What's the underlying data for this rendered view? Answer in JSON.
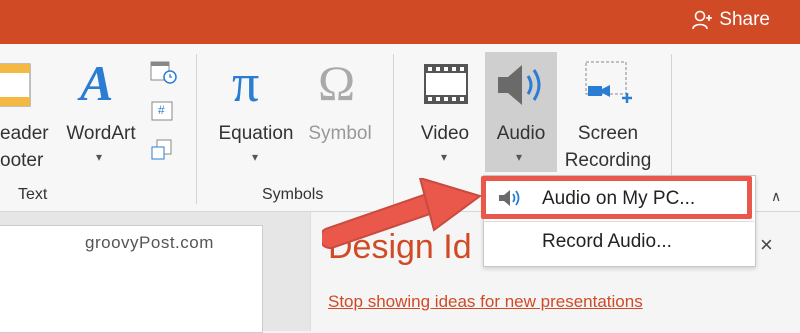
{
  "titlebar": {
    "share_label": "Share"
  },
  "ribbon": {
    "header_footer": {
      "line1": "eader",
      "line2": "ooter"
    },
    "wordart": {
      "label": "WordArt"
    },
    "equation": {
      "label": "Equation"
    },
    "symbol": {
      "label": "Symbol"
    },
    "video": {
      "label": "Video"
    },
    "audio": {
      "label": "Audio"
    },
    "screen_recording": {
      "line1": "Screen",
      "line2": "Recording"
    },
    "groups": {
      "text": "Text",
      "symbols": "Symbols"
    },
    "pi_glyph": "π",
    "omega_glyph": "Ω",
    "wordart_glyph": "A",
    "small_icon_glyph": "#"
  },
  "audio_menu": {
    "items": [
      {
        "label": "Audio on My PC...",
        "icon": "speaker-icon"
      },
      {
        "label": "Record Audio..."
      }
    ]
  },
  "slide": {
    "watermark": "groovyPost.com"
  },
  "design_pane": {
    "title": "Design Id",
    "link": "Stop showing ideas for new presentations",
    "close": "×"
  },
  "colors": {
    "brand": "#d04a26",
    "arrow": "#e9584b",
    "icon_blue": "#2b7cd3"
  }
}
